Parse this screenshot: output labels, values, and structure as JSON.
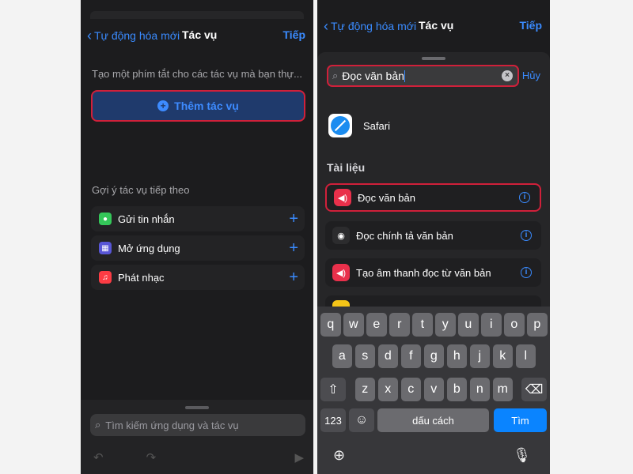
{
  "left": {
    "nav": {
      "back": "Tự động hóa mới",
      "title": "Tác vụ",
      "next": "Tiếp"
    },
    "description": "Tạo một phím tắt cho các tác vụ mà bạn thự...",
    "add_action": "Thêm tác vụ",
    "suggestions_header": "Gợi ý tác vụ tiếp theo",
    "suggestions": [
      {
        "label": "Gửi tin nhắn",
        "icon": "message-icon",
        "color": "#34c759"
      },
      {
        "label": "Mở ứng dụng",
        "icon": "apps-grid-icon",
        "color": "#5856d6"
      },
      {
        "label": "Phát nhạc",
        "icon": "music-icon",
        "color": "#fc3c44"
      }
    ],
    "search_placeholder": "Tìm kiếm ứng dụng và tác vụ"
  },
  "right": {
    "nav": {
      "back": "Tự động hóa mới",
      "title": "Tác vụ",
      "next": "Tiếp"
    },
    "search_value": "Đọc văn bản",
    "cancel": "Hủy",
    "app_result": "Safari",
    "section": "Tài liệu",
    "actions": [
      {
        "label": "Đọc văn bản",
        "icon": "speaker-icon",
        "color": "#e9304b"
      },
      {
        "label": "Đọc chính tả văn bản",
        "icon": "siri-icon",
        "color": "#2c2c2e"
      },
      {
        "label": "Tạo âm thanh đọc từ văn bản",
        "icon": "speaker-icon",
        "color": "#e9304b"
      }
    ],
    "keyboard": {
      "row1": [
        "q",
        "w",
        "e",
        "r",
        "t",
        "y",
        "u",
        "i",
        "o",
        "p"
      ],
      "row2": [
        "a",
        "s",
        "d",
        "f",
        "g",
        "h",
        "j",
        "k",
        "l"
      ],
      "row3": [
        "z",
        "x",
        "c",
        "v",
        "b",
        "n",
        "m"
      ],
      "num_key": "123",
      "space_key": "dấu cách",
      "go_key": "Tìm"
    }
  }
}
